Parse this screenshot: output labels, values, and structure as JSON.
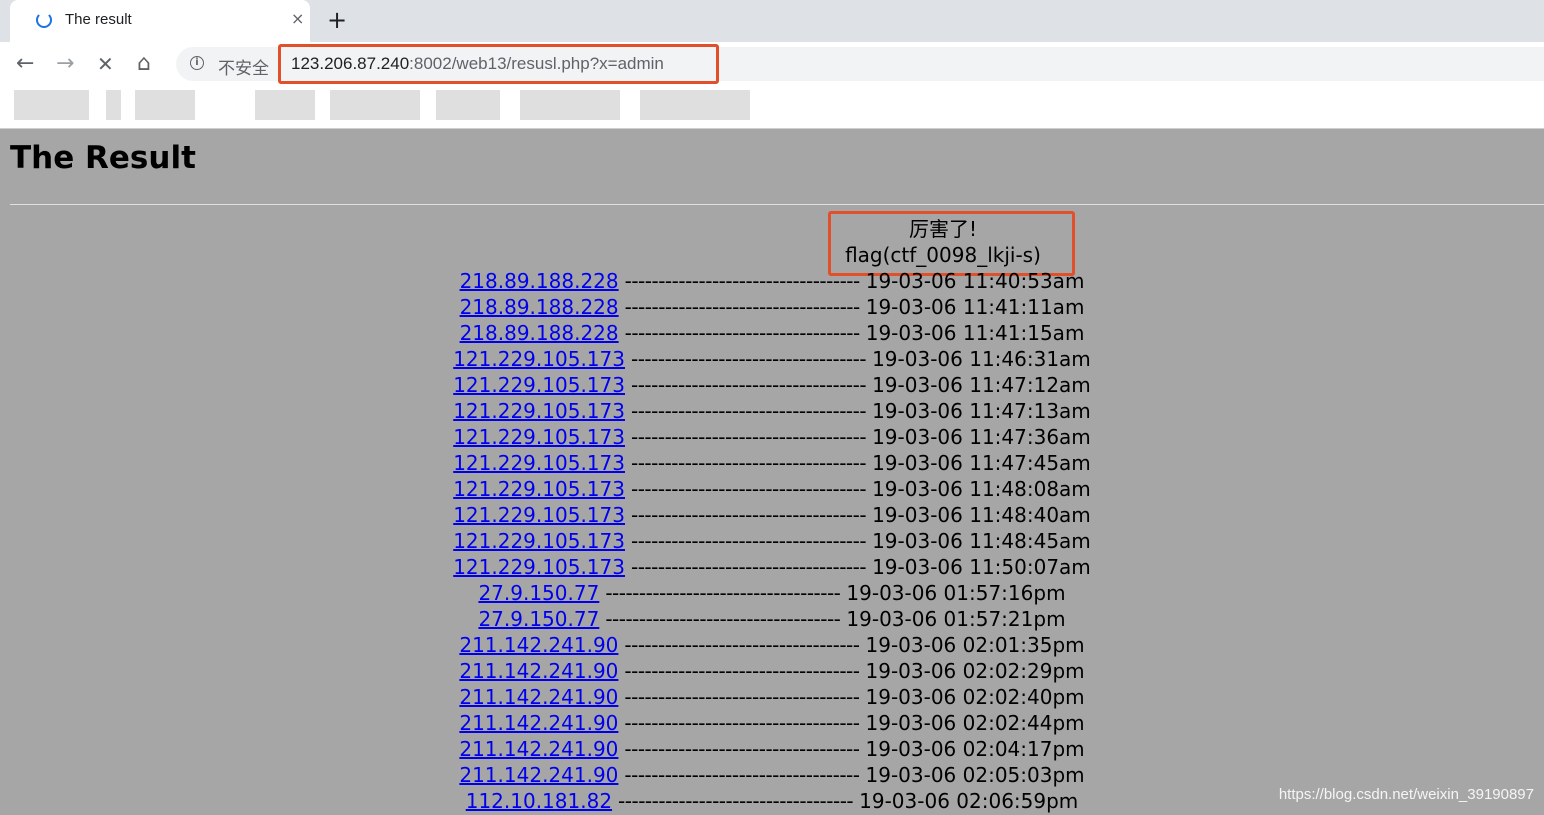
{
  "browser": {
    "tab_title": "The result",
    "tab_close": "×",
    "new_tab": "+",
    "back": "←",
    "forward": "→",
    "stop": "✕",
    "home": "⌂",
    "info": "i",
    "security_label": "不安全",
    "url_host": "123.206.87.240",
    "url_rest": ":8002/web13/resusl.php?x=admin"
  },
  "page": {
    "title": "The Result",
    "message_line1": "厉害了!",
    "message_line2": "flag(ctf_0098_lkji-s)",
    "rows": [
      {
        "ip": "218.89.188.228",
        "dashes": "-----------------------------------",
        "time": "19-03-06 11:40:53am"
      },
      {
        "ip": "218.89.188.228",
        "dashes": "-----------------------------------",
        "time": "19-03-06 11:41:11am"
      },
      {
        "ip": "218.89.188.228",
        "dashes": "-----------------------------------",
        "time": "19-03-06 11:41:15am"
      },
      {
        "ip": "121.229.105.173",
        "dashes": "-----------------------------------",
        "time": "19-03-06 11:46:31am"
      },
      {
        "ip": "121.229.105.173",
        "dashes": "-----------------------------------",
        "time": "19-03-06 11:47:12am"
      },
      {
        "ip": "121.229.105.173",
        "dashes": "-----------------------------------",
        "time": "19-03-06 11:47:13am"
      },
      {
        "ip": "121.229.105.173",
        "dashes": "-----------------------------------",
        "time": "19-03-06 11:47:36am"
      },
      {
        "ip": "121.229.105.173",
        "dashes": "-----------------------------------",
        "time": "19-03-06 11:47:45am"
      },
      {
        "ip": "121.229.105.173",
        "dashes": "-----------------------------------",
        "time": "19-03-06 11:48:08am"
      },
      {
        "ip": "121.229.105.173",
        "dashes": "-----------------------------------",
        "time": "19-03-06 11:48:40am"
      },
      {
        "ip": "121.229.105.173",
        "dashes": "-----------------------------------",
        "time": "19-03-06 11:48:45am"
      },
      {
        "ip": "121.229.105.173",
        "dashes": "-----------------------------------",
        "time": "19-03-06 11:50:07am"
      },
      {
        "ip": "27.9.150.77",
        "dashes": "-----------------------------------",
        "time": "19-03-06 01:57:16pm"
      },
      {
        "ip": "27.9.150.77",
        "dashes": "-----------------------------------",
        "time": "19-03-06 01:57:21pm"
      },
      {
        "ip": "211.142.241.90",
        "dashes": "-----------------------------------",
        "time": "19-03-06 02:01:35pm"
      },
      {
        "ip": "211.142.241.90",
        "dashes": "-----------------------------------",
        "time": "19-03-06 02:02:29pm"
      },
      {
        "ip": "211.142.241.90",
        "dashes": "-----------------------------------",
        "time": "19-03-06 02:02:40pm"
      },
      {
        "ip": "211.142.241.90",
        "dashes": "-----------------------------------",
        "time": "19-03-06 02:02:44pm"
      },
      {
        "ip": "211.142.241.90",
        "dashes": "-----------------------------------",
        "time": "19-03-06 02:04:17pm"
      },
      {
        "ip": "211.142.241.90",
        "dashes": "-----------------------------------",
        "time": "19-03-06 02:05:03pm"
      },
      {
        "ip": "112.10.181.82",
        "dashes": "-----------------------------------",
        "time": "19-03-06 02:06:59pm"
      }
    ],
    "watermark": "https://blog.csdn.net/weixin_39190897"
  },
  "colors": {
    "page_background": "#a6a6a6",
    "link": "#0000ee",
    "highlight_border": "#e0502b"
  }
}
